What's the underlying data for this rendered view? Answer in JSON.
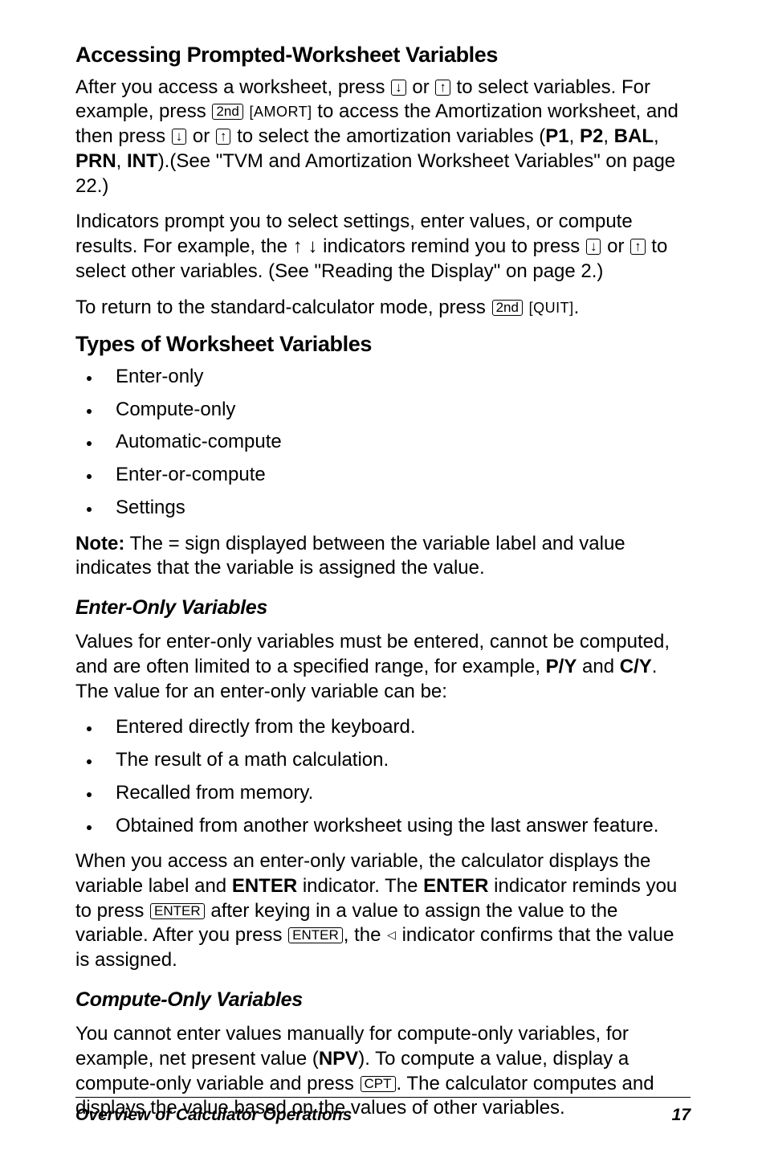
{
  "section1": {
    "title": "Accessing Prompted-Worksheet Variables",
    "p1a": "After you access a worksheet, press ",
    "key_down": "↓",
    "p1b": " or ",
    "key_up": "↑",
    "p1c": " to select variables. For example, press ",
    "key_2nd": "2nd",
    "alt_amort": "[AMORT]",
    "p1d": " to access the Amortization worksheet, and then press ",
    "p1e": " or ",
    "p1f": " to select the amortization variables (",
    "v_p1": "P1",
    "c1": ", ",
    "v_p2": "P2",
    "c2": ", ",
    "v_bal": "BAL",
    "c3": ", ",
    "v_prn": "PRN",
    "c4": ", ",
    "v_int": "INT",
    "p1g": ").(See \"TVM and Amortization Worksheet Variables\" on page 22.)",
    "p2a": "Indicators prompt you to select settings, enter values, or compute results. For example, the ",
    "arrows": "↑ ↓",
    "p2b": " indicators remind you to press ",
    "p2c": " or ",
    "p2d": " to select other variables. (See \"Reading the Display\" on page 2.)",
    "p3a": "To return to the standard-calculator mode, press ",
    "alt_quit": "[QUIT]",
    "p3b": "."
  },
  "section2": {
    "title": "Types of Worksheet Variables",
    "items": [
      "Enter-only",
      "Compute-only",
      "Automatic-compute",
      "Enter-or-compute",
      "Settings"
    ],
    "note_label": "Note:",
    "note_a": " The ",
    "note_eq": "=",
    "note_b": " sign displayed between the variable label and value indicates that the variable is assigned the value."
  },
  "section3": {
    "title": "Enter-Only Variables",
    "p1a": "Values for enter-only variables must be entered, cannot be computed, and are often limited to a specified range, for example, ",
    "v_py": "P/Y",
    "and": " and ",
    "v_cy": "C/Y",
    "p1b": ". The value for an enter-only variable can be:",
    "items": [
      "Entered directly from the keyboard.",
      "The result of a math calculation.",
      "Recalled from memory.",
      "Obtained from another worksheet using the last answer feature."
    ],
    "p2a": "When you access an enter-only variable, the calculator displays the variable label and ",
    "v_enter1": "ENTER",
    "p2b": " indicator. The ",
    "v_enter2": "ENTER",
    "p2c": " indicator reminds you to press ",
    "key_enter": "ENTER",
    "p2d": " after keying in a value to assign the value to the variable. After you press ",
    "p2e": ", the ",
    "tri": "◁",
    "p2f": " indicator confirms that the value is assigned."
  },
  "section4": {
    "title": "Compute-Only Variables",
    "p1a": "You cannot enter values manually for compute-only variables, for example, net present value (",
    "v_npv": "NPV",
    "p1b": "). To compute a value, display a compute-only variable and press ",
    "key_cpt": "CPT",
    "p1c": ". The calculator computes and displays the value based on the values of other variables."
  },
  "footer": {
    "left": "Overview of Calculator Operations",
    "right": "17"
  }
}
